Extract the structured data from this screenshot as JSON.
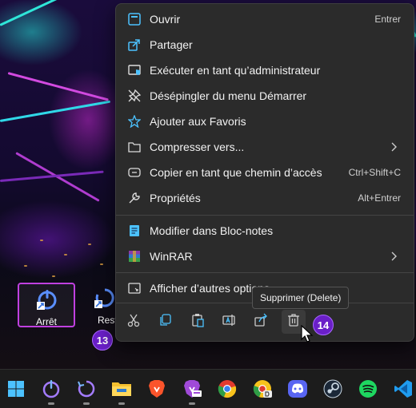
{
  "context_menu": {
    "items": [
      {
        "label": "Ouvrir",
        "shortcut": "Entrer",
        "icon": "open-app-icon"
      },
      {
        "label": "Partager",
        "icon": "share-icon"
      },
      {
        "label": "Exécuter en tant qu’administrateur",
        "icon": "shield-icon"
      },
      {
        "label": "Désépingler du menu Démarrer",
        "icon": "unpin-icon"
      },
      {
        "label": "Ajouter aux Favoris",
        "icon": "star-icon"
      },
      {
        "label": "Compresser vers...",
        "icon": "folder-zip-icon",
        "submenu": true
      },
      {
        "label": "Copier en tant que chemin d’accès",
        "shortcut": "Ctrl+Shift+C",
        "icon": "copy-path-icon"
      },
      {
        "label": "Propriétés",
        "shortcut": "Alt+Entrer",
        "icon": "wrench-icon"
      },
      {
        "label": "Modifier dans Bloc-notes",
        "icon": "notepad-icon"
      },
      {
        "label": "WinRAR",
        "icon": "winrar-icon",
        "submenu": true
      },
      {
        "label": "Afficher d’autres options",
        "icon": "more-options-icon"
      }
    ],
    "quick_actions": [
      "cut-icon",
      "copy-icon",
      "paste-icon",
      "rename-icon",
      "share-icon",
      "delete-icon"
    ]
  },
  "tooltip": "Supprimer (Delete)",
  "desktop_icons": [
    {
      "label": "Arrêt",
      "icon": "power-icon"
    },
    {
      "label": "Rest",
      "icon": "restart-icon"
    }
  ],
  "badges": {
    "restart": "13",
    "delete": "14"
  },
  "taskbar": [
    "windows-start-icon",
    "power-app-icon",
    "restart-app-icon",
    "file-explorer-icon",
    "brave-icon",
    "brave-beta-icon",
    "chrome-icon",
    "chrome-dev-icon",
    "discord-icon",
    "steam-icon",
    "spotify-icon",
    "vscode-icon"
  ],
  "colors": {
    "menu_bg": "#2b2b2b",
    "accent": "#4cc2ff",
    "badge": "#6a1fc8",
    "selection": "#c040e0"
  }
}
